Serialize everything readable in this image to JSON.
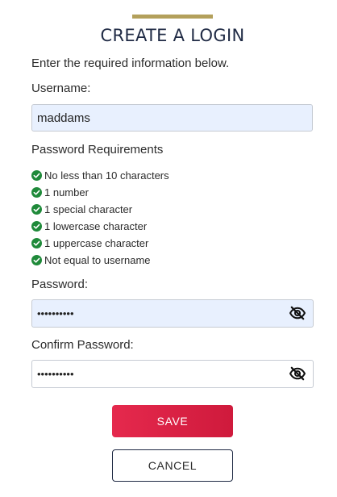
{
  "header": {
    "title": "CREATE A LOGIN",
    "subtitle": "Enter the required information below."
  },
  "username": {
    "label": "Username:",
    "value": "maddams"
  },
  "requirements": {
    "title": "Password Requirements",
    "items": [
      {
        "label": "No less than 10 characters",
        "icon": "check-circle-icon"
      },
      {
        "label": "1 number",
        "icon": "check-circle-icon"
      },
      {
        "label": "1 special character",
        "icon": "check-circle-icon"
      },
      {
        "label": "1 lowercase character",
        "icon": "check-circle-icon"
      },
      {
        "label": "1 uppercase character",
        "icon": "check-circle-icon"
      },
      {
        "label": "Not equal to username",
        "icon": "check-circle-icon"
      }
    ]
  },
  "password": {
    "label": "Password:",
    "value": "••••••••••",
    "toggle_icon": "eye-slash-icon"
  },
  "confirm_password": {
    "label": "Confirm Password:",
    "value": "••••••••••",
    "toggle_icon": "eye-slash-icon"
  },
  "actions": {
    "save_label": "SAVE",
    "cancel_label": "CANCEL"
  },
  "colors": {
    "accent": "#b3a05b",
    "title": "#1f2a44",
    "primary_button": "#e5294d",
    "check": "#1f8a3a",
    "autofill_bg": "#e8f0fe"
  }
}
